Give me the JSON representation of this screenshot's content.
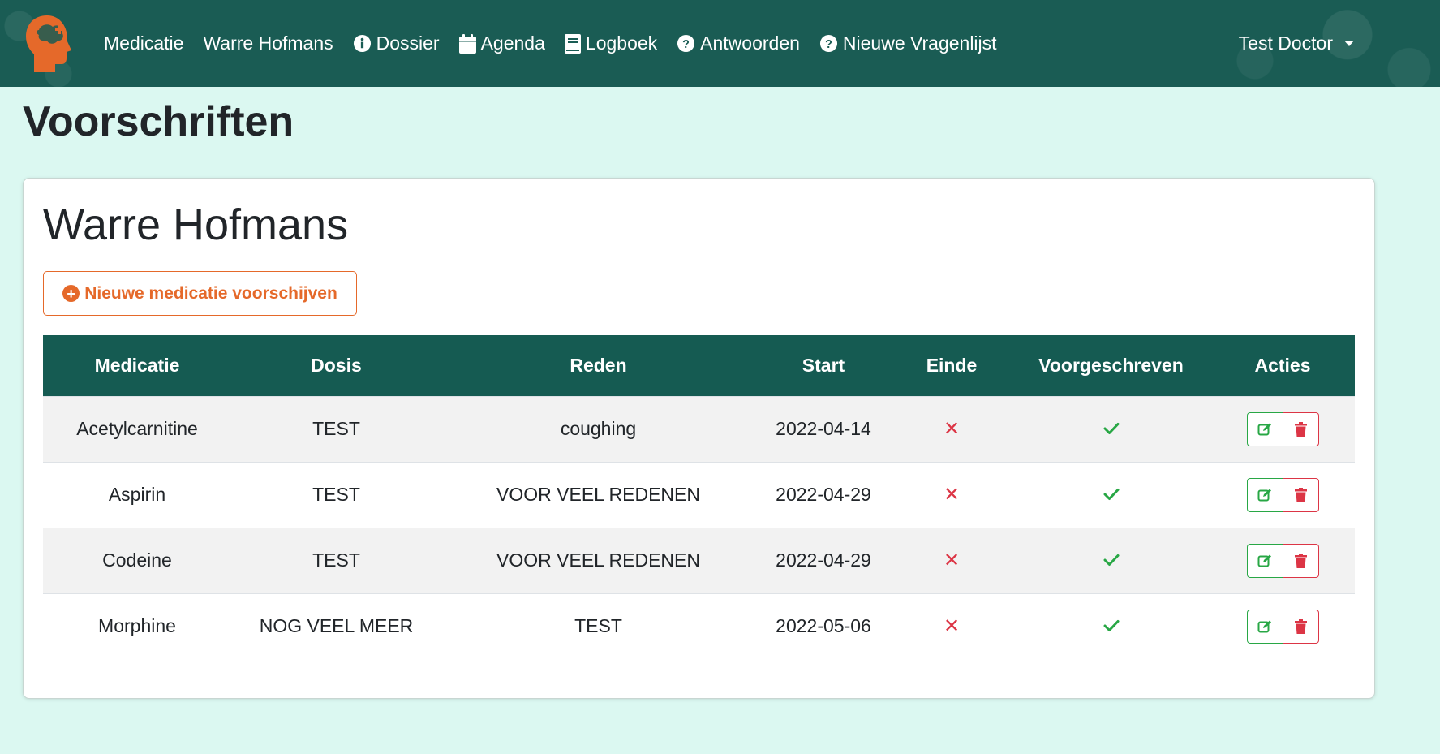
{
  "nav": {
    "items": [
      {
        "label": "Medicatie",
        "icon": ""
      },
      {
        "label": "Warre Hofmans",
        "icon": ""
      },
      {
        "label": "Dossier",
        "icon": "info-circle-icon"
      },
      {
        "label": "Agenda",
        "icon": "calendar-icon"
      },
      {
        "label": "Logboek",
        "icon": "book-icon"
      },
      {
        "label": "Antwoorden",
        "icon": "question-circle-icon"
      },
      {
        "label": "Nieuwe Vragenlijst",
        "icon": "question-circle-icon"
      }
    ],
    "user": "Test Doctor"
  },
  "page": {
    "title": "Voorschriften"
  },
  "card": {
    "patient_name": "Warre Hofmans",
    "new_button_label": "Nieuwe medicatie voorschijven"
  },
  "table": {
    "headers": [
      "Medicatie",
      "Dosis",
      "Reden",
      "Start",
      "Einde",
      "Voorgeschreven",
      "Acties"
    ],
    "rows": [
      {
        "medicatie": "Acetylcarnitine",
        "dosis": "TEST",
        "reden": "coughing",
        "start": "2022-04-14",
        "einde": "✕"
      },
      {
        "medicatie": "Aspirin",
        "dosis": "TEST",
        "reden": "VOOR VEEL REDENEN",
        "start": "2022-04-29",
        "einde": "✕"
      },
      {
        "medicatie": "Codeine",
        "dosis": "TEST",
        "reden": "VOOR VEEL REDENEN",
        "start": "2022-04-29",
        "einde": "✕"
      },
      {
        "medicatie": "Morphine",
        "dosis": "NOG VEEL MEER",
        "reden": "TEST",
        "start": "2022-05-06",
        "einde": "✕"
      }
    ]
  },
  "colors": {
    "navbar": "#1a5c54",
    "background": "#dbf8f1",
    "accent": "#e5692a",
    "table_header": "#155b52",
    "success": "#28a745",
    "danger": "#dc3545"
  }
}
